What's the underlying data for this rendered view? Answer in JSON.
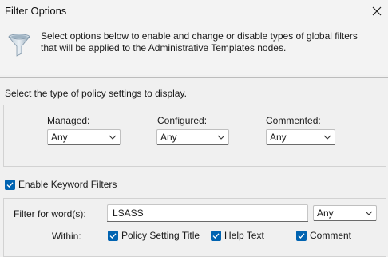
{
  "window": {
    "title": "Filter Options",
    "close_icon": "close-icon"
  },
  "header": {
    "icon": "funnel-icon",
    "description": "Select options below to enable and change or disable types of global filters that will be applied to the Administrative Templates nodes."
  },
  "policy_type": {
    "prompt": "Select the type of policy settings to display.",
    "managed": {
      "label": "Managed:",
      "value": "Any"
    },
    "configured": {
      "label": "Configured:",
      "value": "Any"
    },
    "commented": {
      "label": "Commented:",
      "value": "Any"
    }
  },
  "keyword": {
    "enable_label": "Enable Keyword Filters",
    "enable_checked": true,
    "filter_label": "Filter for word(s):",
    "filter_value": "LSASS",
    "match_value": "Any",
    "within_label": "Within:",
    "within": [
      {
        "label": "Policy Setting Title",
        "checked": true
      },
      {
        "label": "Help Text",
        "checked": true
      },
      {
        "label": "Comment",
        "checked": true
      }
    ]
  },
  "colors": {
    "checkbox_accent": "#0063b1",
    "background": "#f0f0f0"
  }
}
